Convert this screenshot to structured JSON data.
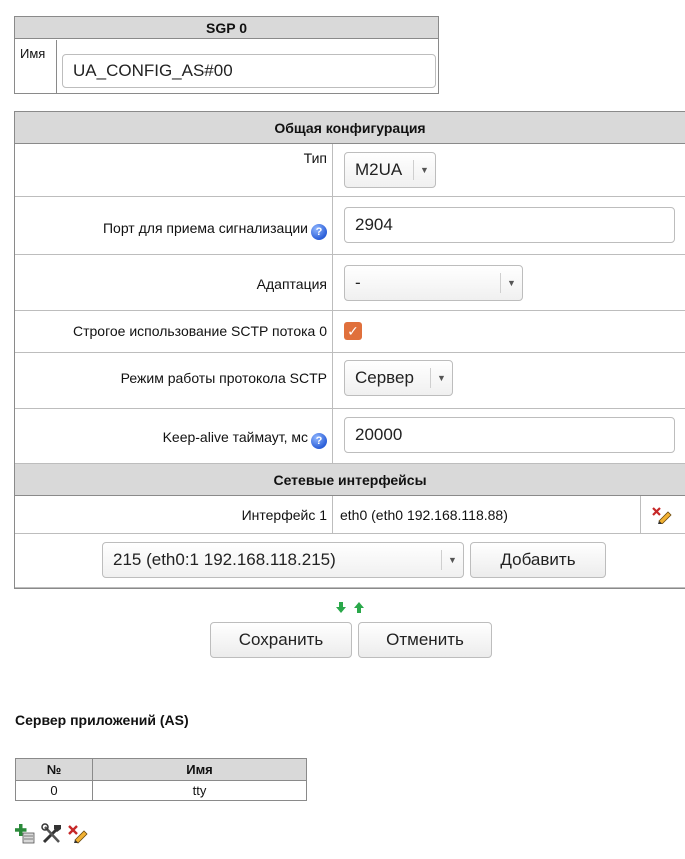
{
  "sgp": {
    "title": "SGP 0",
    "name_label": "Имя",
    "name_value": "UA_CONFIG_AS#00"
  },
  "general": {
    "header": "Общая конфигурация",
    "type_label": "Тип",
    "type_value": "M2UA",
    "port_label": "Порт для приема сигнализации",
    "port_value": "2904",
    "adaptation_label": "Адаптация",
    "adaptation_value": "-",
    "strict_sctp_label": "Строгое использование SCTP потока 0",
    "strict_sctp_checked": true,
    "sctp_mode_label": "Режим работы протокола SCTP",
    "sctp_mode_value": "Сервер",
    "keepalive_label": "Keep-alive таймаут, мс",
    "keepalive_value": "20000"
  },
  "network": {
    "header": "Сетевые интерфейсы",
    "interface1_label": "Интерфейс 1",
    "interface1_value": "eth0 (eth0 192.168.118.88)",
    "new_interface_value": "215 (eth0:1 192.168.118.215)",
    "add_button": "Добавить"
  },
  "actions": {
    "save": "Сохранить",
    "cancel": "Отменить"
  },
  "as_section": {
    "title": "Сервер приложений (AS)",
    "columns": [
      "№",
      "Имя"
    ],
    "rows": [
      [
        "0",
        "tty"
      ]
    ]
  },
  "colors": {
    "header_bg": "#d9d9d9",
    "checkbox": "#e0703c",
    "help_icon": "#2c5fd8",
    "arrow_green": "#2aa84a"
  }
}
